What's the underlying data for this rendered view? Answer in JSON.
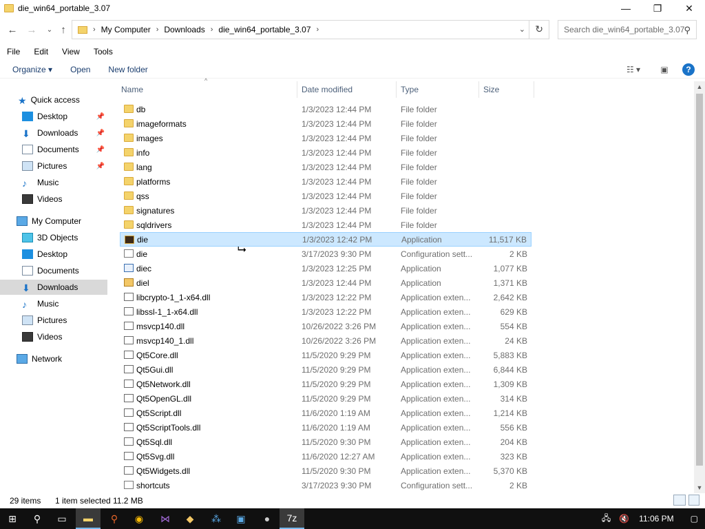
{
  "window": {
    "title": "die_win64_portable_3.07",
    "minimize": "—",
    "maximize": "❐",
    "close": "✕"
  },
  "address": {
    "crumbs": [
      "My Computer",
      "Downloads",
      "die_win64_portable_3.07"
    ],
    "search_placeholder": "Search die_win64_portable_3.07"
  },
  "menu": {
    "items": [
      "File",
      "Edit",
      "View",
      "Tools"
    ]
  },
  "commands": {
    "organize": "Organize ▾",
    "open": "Open",
    "new_folder": "New folder"
  },
  "nav": {
    "items": [
      {
        "label": "Quick access"
      },
      {
        "label": "Desktop"
      },
      {
        "label": "Downloads"
      },
      {
        "label": "Documents"
      },
      {
        "label": "Pictures"
      },
      {
        "label": "Music"
      },
      {
        "label": "Videos"
      },
      {
        "label": "My Computer"
      },
      {
        "label": "3D Objects"
      },
      {
        "label": "Desktop"
      },
      {
        "label": "Documents"
      },
      {
        "label": "Downloads"
      },
      {
        "label": "Music"
      },
      {
        "label": "Pictures"
      },
      {
        "label": "Videos"
      },
      {
        "label": "Network"
      }
    ]
  },
  "columns": {
    "name": "Name",
    "date": "Date modified",
    "type": "Type",
    "size": "Size"
  },
  "files": [
    {
      "name": "db",
      "date": "1/3/2023 12:44 PM",
      "type": "File folder",
      "size": "",
      "icon": "folder"
    },
    {
      "name": "imageformats",
      "date": "1/3/2023 12:44 PM",
      "type": "File folder",
      "size": "",
      "icon": "folder"
    },
    {
      "name": "images",
      "date": "1/3/2023 12:44 PM",
      "type": "File folder",
      "size": "",
      "icon": "folder"
    },
    {
      "name": "info",
      "date": "1/3/2023 12:44 PM",
      "type": "File folder",
      "size": "",
      "icon": "folder"
    },
    {
      "name": "lang",
      "date": "1/3/2023 12:44 PM",
      "type": "File folder",
      "size": "",
      "icon": "folder"
    },
    {
      "name": "platforms",
      "date": "1/3/2023 12:44 PM",
      "type": "File folder",
      "size": "",
      "icon": "folder"
    },
    {
      "name": "qss",
      "date": "1/3/2023 12:44 PM",
      "type": "File folder",
      "size": "",
      "icon": "folder"
    },
    {
      "name": "signatures",
      "date": "1/3/2023 12:44 PM",
      "type": "File folder",
      "size": "",
      "icon": "folder"
    },
    {
      "name": "sqldrivers",
      "date": "1/3/2023 12:44 PM",
      "type": "File folder",
      "size": "",
      "icon": "folder"
    },
    {
      "name": "die",
      "date": "1/3/2023 12:42 PM",
      "type": "Application",
      "size": "11,517 KB",
      "icon": "app-die"
    },
    {
      "name": "die",
      "date": "3/17/2023 9:30 PM",
      "type": "Configuration sett...",
      "size": "2 KB",
      "icon": "config"
    },
    {
      "name": "diec",
      "date": "1/3/2023 12:25 PM",
      "type": "Application",
      "size": "1,077 KB",
      "icon": "exe"
    },
    {
      "name": "diel",
      "date": "1/3/2023 12:44 PM",
      "type": "Application",
      "size": "1,371 KB",
      "icon": "diel"
    },
    {
      "name": "libcrypto-1_1-x64.dll",
      "date": "1/3/2023 12:22 PM",
      "type": "Application exten...",
      "size": "2,642 KB",
      "icon": "dll"
    },
    {
      "name": "libssl-1_1-x64.dll",
      "date": "1/3/2023 12:22 PM",
      "type": "Application exten...",
      "size": "629 KB",
      "icon": "dll"
    },
    {
      "name": "msvcp140.dll",
      "date": "10/26/2022 3:26 PM",
      "type": "Application exten...",
      "size": "554 KB",
      "icon": "dll"
    },
    {
      "name": "msvcp140_1.dll",
      "date": "10/26/2022 3:26 PM",
      "type": "Application exten...",
      "size": "24 KB",
      "icon": "dll"
    },
    {
      "name": "Qt5Core.dll",
      "date": "11/5/2020 9:29 PM",
      "type": "Application exten...",
      "size": "5,883 KB",
      "icon": "dll"
    },
    {
      "name": "Qt5Gui.dll",
      "date": "11/5/2020 9:29 PM",
      "type": "Application exten...",
      "size": "6,844 KB",
      "icon": "dll"
    },
    {
      "name": "Qt5Network.dll",
      "date": "11/5/2020 9:29 PM",
      "type": "Application exten...",
      "size": "1,309 KB",
      "icon": "dll"
    },
    {
      "name": "Qt5OpenGL.dll",
      "date": "11/5/2020 9:29 PM",
      "type": "Application exten...",
      "size": "314 KB",
      "icon": "dll"
    },
    {
      "name": "Qt5Script.dll",
      "date": "11/6/2020 1:19 AM",
      "type": "Application exten...",
      "size": "1,214 KB",
      "icon": "dll"
    },
    {
      "name": "Qt5ScriptTools.dll",
      "date": "11/6/2020 1:19 AM",
      "type": "Application exten...",
      "size": "556 KB",
      "icon": "dll"
    },
    {
      "name": "Qt5Sql.dll",
      "date": "11/5/2020 9:30 PM",
      "type": "Application exten...",
      "size": "204 KB",
      "icon": "dll"
    },
    {
      "name": "Qt5Svg.dll",
      "date": "11/6/2020 12:27 AM",
      "type": "Application exten...",
      "size": "323 KB",
      "icon": "dll"
    },
    {
      "name": "Qt5Widgets.dll",
      "date": "11/5/2020 9:30 PM",
      "type": "Application exten...",
      "size": "5,370 KB",
      "icon": "dll"
    },
    {
      "name": "shortcuts",
      "date": "3/17/2023 9:30 PM",
      "type": "Configuration sett...",
      "size": "2 KB",
      "icon": "config"
    }
  ],
  "selected_file_index": 9,
  "status": {
    "count": "29 items",
    "selected": "1 item selected",
    "size": "11.2 MB"
  },
  "taskbar": {
    "clock": "11:06 PM"
  }
}
